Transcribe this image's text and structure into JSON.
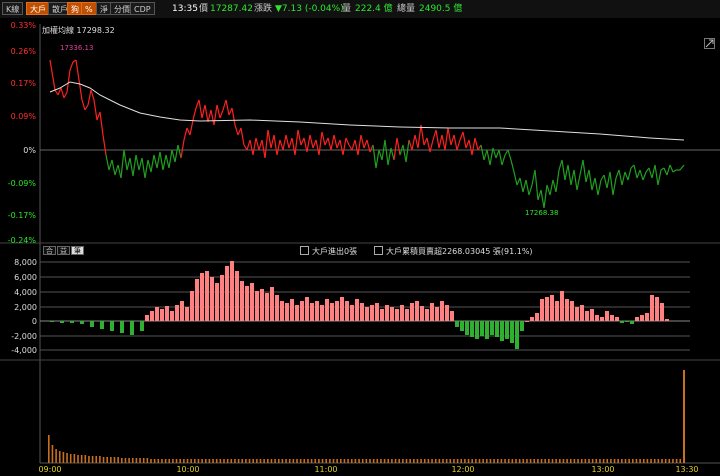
{
  "toolbar": {
    "buttons": [
      "K線",
      "大戶",
      "散戶",
      "狗",
      "%",
      "淨",
      "分價",
      "CDP"
    ],
    "time": "13:35",
    "price_label": "價",
    "price_value": "17287.42",
    "change_label": "漲跌",
    "change_value": "▼7.13 (-0.04%)",
    "volume_label": "量",
    "volume_value": "222.4 億",
    "total_label": "總量",
    "total_value": "2490.5 億"
  },
  "main_chart": {
    "title": "加權均線 17298.32",
    "pct_labels": [
      "0.33%",
      "0.26%",
      "0.17%",
      "0.09%",
      "0%",
      "-0.09%",
      "-0.17%",
      "-0.24%"
    ],
    "high_label": "17336.13",
    "low_label": "17268.38"
  },
  "mid_panel": {
    "side_buttons": [
      "合",
      "益",
      "筆"
    ],
    "legend1": "大戶進出0張",
    "legend2": "大戶累積買賣超2268.03045 張(91.1%)",
    "y_labels": [
      "8,000",
      "6,000",
      "4,000",
      "2,000",
      "0",
      "-2,000",
      "-4,000"
    ]
  },
  "x_labels": [
    "09:00",
    "10:00",
    "11:00",
    "12:00",
    "13:00",
    "13:30"
  ],
  "colors": {
    "up": "#ff2020",
    "down": "#20a020",
    "avg": "#e0e0e0",
    "up_fill": "#ff8080",
    "down_fill": "#30b030",
    "volume": "#c87020"
  }
}
